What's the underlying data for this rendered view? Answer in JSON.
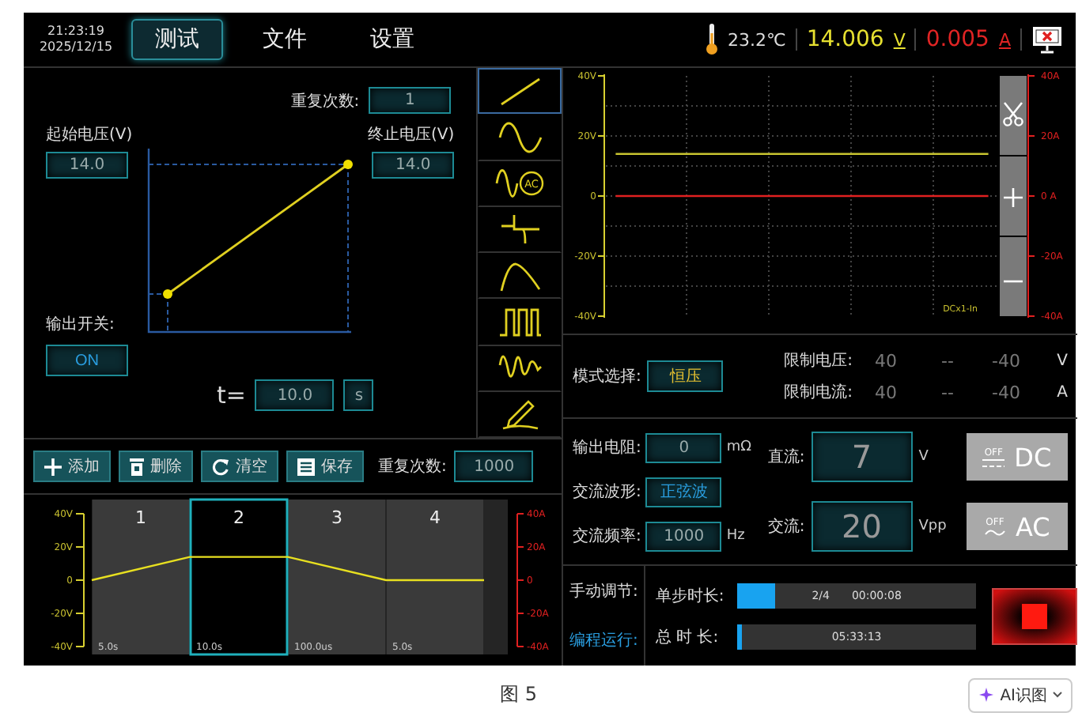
{
  "header": {
    "time": "21:23:19",
    "date": "2025/12/15",
    "tabs": [
      {
        "label": "测试",
        "selected": true
      },
      {
        "label": "文件",
        "selected": false
      },
      {
        "label": "设置",
        "selected": false
      }
    ],
    "temperature": "23.2℃",
    "voltage": "14.006",
    "voltage_unit": "V",
    "current": "0.005",
    "current_unit": "A"
  },
  "ramp_editor": {
    "repeat_label": "重复次数:",
    "repeat_value": "1",
    "start_label": "起始电压(V)",
    "start_value": "14.0",
    "end_label": "终止电压(V)",
    "end_value": "14.0",
    "output_switch_label": "输出开关:",
    "output_switch_value": "ON",
    "time_label": "t=",
    "time_value": "10.0",
    "time_unit": "s"
  },
  "waveforms": [
    {
      "kind": "ramp",
      "selected": true
    },
    {
      "kind": "sine",
      "selected": false
    },
    {
      "kind": "sine-ac",
      "selected": false,
      "badge": "AC"
    },
    {
      "kind": "spike",
      "selected": false
    },
    {
      "kind": "hump",
      "selected": false
    },
    {
      "kind": "square",
      "selected": false
    },
    {
      "kind": "damped",
      "selected": false
    },
    {
      "kind": "pencil",
      "selected": false
    }
  ],
  "toolbar": {
    "buttons": [
      {
        "kind": "add",
        "label": "添加"
      },
      {
        "kind": "delete",
        "label": "删除"
      },
      {
        "kind": "clear",
        "label": "清空"
      },
      {
        "kind": "save",
        "label": "保存"
      }
    ],
    "repeat_label": "重复次数:",
    "repeat_value": "1000"
  },
  "step_chart": {
    "steps": [
      {
        "label": "1",
        "duration": "5.0s",
        "selected": false
      },
      {
        "label": "2",
        "duration": "10.0s",
        "selected": true
      },
      {
        "label": "3",
        "duration": "100.0us",
        "selected": false
      },
      {
        "label": "4",
        "duration": "5.0s",
        "selected": false
      }
    ],
    "chart_data": {
      "type": "line",
      "ylim": [
        -40,
        40
      ],
      "yticks": [
        {
          "value": 40,
          "label": "40V"
        },
        {
          "value": 20,
          "label": "20V"
        },
        {
          "value": 0,
          "label": "0"
        },
        {
          "value": -20,
          "label": "-20V"
        },
        {
          "value": -40,
          "label": "-40V"
        }
      ],
      "series": [
        {
          "color": "#e8e020",
          "values": [
            0,
            14,
            14,
            0,
            0
          ]
        }
      ]
    },
    "right_axis_labels": [
      "40A",
      "20A",
      "0",
      "-20A",
      "-40A"
    ]
  },
  "scope": {
    "chart_data": {
      "type": "line",
      "grid": true,
      "ylim": [
        -40,
        40
      ],
      "yticks": [
        {
          "value": 40,
          "label": "40V"
        },
        {
          "value": 20,
          "label": "20V"
        },
        {
          "value": 0,
          "label": "0"
        },
        {
          "value": -20,
          "label": "-20V"
        },
        {
          "value": -40,
          "label": "-40V"
        }
      ],
      "series": [
        {
          "color": "#c8c430",
          "values": [
            14,
            14,
            14,
            14,
            14,
            14,
            14,
            14,
            14,
            14,
            14,
            14,
            14,
            14,
            14,
            14,
            14,
            14,
            14,
            14
          ]
        },
        {
          "color": "#e02020",
          "values": [
            0,
            0,
            0,
            0,
            0,
            0,
            0,
            0,
            0,
            0,
            0,
            0,
            0,
            0,
            0,
            0,
            0,
            0,
            0,
            0
          ]
        }
      ]
    },
    "right_axis_labels": [
      "40A",
      "20A",
      "0 A",
      "-20A",
      "-40A"
    ],
    "range_label": "DCx1-In"
  },
  "mode": {
    "label": "模式选择:",
    "value": "恒压",
    "limits": [
      {
        "label": "限制电压:",
        "max": "40",
        "separator": "--",
        "min": "-40",
        "unit": "V"
      },
      {
        "label": "限制电流:",
        "max": "40",
        "separator": "--",
        "min": "-40",
        "unit": "A"
      }
    ]
  },
  "output": {
    "fields": [
      {
        "kind": "number",
        "label": "输出电阻:",
        "value": "0",
        "unit": "mΩ"
      },
      {
        "kind": "option",
        "label": "交流波形:",
        "value": "正弦波"
      },
      {
        "kind": "number",
        "label": "交流频率:",
        "value": "1000",
        "unit": "Hz"
      }
    ],
    "channels": [
      {
        "kind": "dc",
        "label": "直流:",
        "value": "7",
        "unit": "V",
        "switch_state": "OFF",
        "switch_label": "DC",
        "on": false
      },
      {
        "kind": "ac",
        "label": "交流:",
        "value": "20",
        "unit": "Vpp",
        "switch_state": "OFF",
        "switch_label": "AC",
        "on": false
      }
    ]
  },
  "program": {
    "tabs": [
      {
        "label": "手动调节:",
        "selected": false
      },
      {
        "label": "编程运行:",
        "selected": true
      }
    ],
    "progress": [
      {
        "label": "单步时长:",
        "level": 0.16,
        "texts": [
          "2/4",
          "00:00:08"
        ]
      },
      {
        "label": "总 时 长:",
        "level": 0.015,
        "texts": [
          "05:33:13"
        ]
      }
    ]
  },
  "caption": "图 5",
  "ai_button": {
    "label": "AI识图"
  }
}
